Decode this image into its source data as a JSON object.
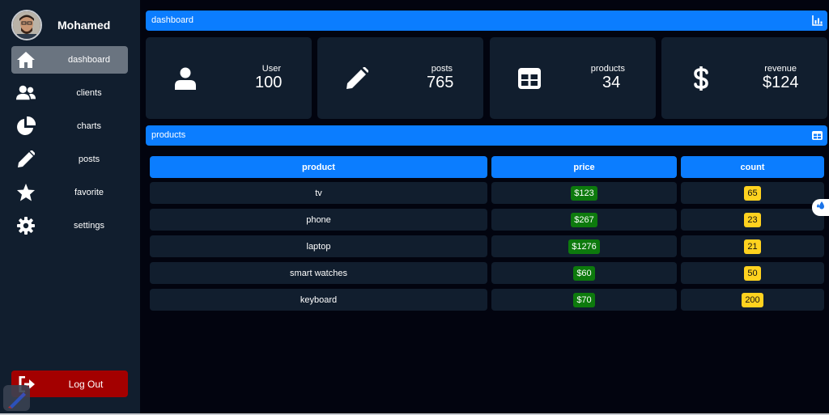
{
  "profile": {
    "name": "Mohamed"
  },
  "sidebar": {
    "items": [
      {
        "label": "dashboard",
        "icon": "home-icon",
        "active": true
      },
      {
        "label": "clients",
        "icon": "users-icon"
      },
      {
        "label": "charts",
        "icon": "pie-chart-icon"
      },
      {
        "label": "posts",
        "icon": "pencil-icon"
      },
      {
        "label": "favorite",
        "icon": "star-icon"
      },
      {
        "label": "settings",
        "icon": "gear-icon"
      }
    ],
    "logout": "Log Out"
  },
  "header": {
    "title": "dashboard",
    "icon": "chart-icon"
  },
  "stats": [
    {
      "label": "User",
      "value": "100",
      "icon": "user-icon"
    },
    {
      "label": "posts",
      "value": "765",
      "icon": "pencil-icon"
    },
    {
      "label": "products",
      "value": "34",
      "icon": "table-icon"
    },
    {
      "label": "revenue",
      "value": "$124",
      "icon": "dollar-icon"
    }
  ],
  "products_panel": {
    "title": "products",
    "icon": "table-icon",
    "columns": [
      "product",
      "price",
      "count"
    ],
    "rows": [
      {
        "product": "tv",
        "price": "$123",
        "count": "65"
      },
      {
        "product": "phone",
        "price": "$267",
        "count": "23"
      },
      {
        "product": "laptop",
        "price": "$1276",
        "count": "21"
      },
      {
        "product": "smart watches",
        "price": "$60",
        "count": "50"
      },
      {
        "product": "keyboard",
        "price": "$70",
        "count": "200"
      }
    ]
  },
  "colors": {
    "accent": "#0b7dff",
    "panel": "#111e2e",
    "background": "#02040f",
    "logout": "#a30000",
    "price_badge": "#0d7a0d",
    "count_badge": "#ffd21f"
  }
}
